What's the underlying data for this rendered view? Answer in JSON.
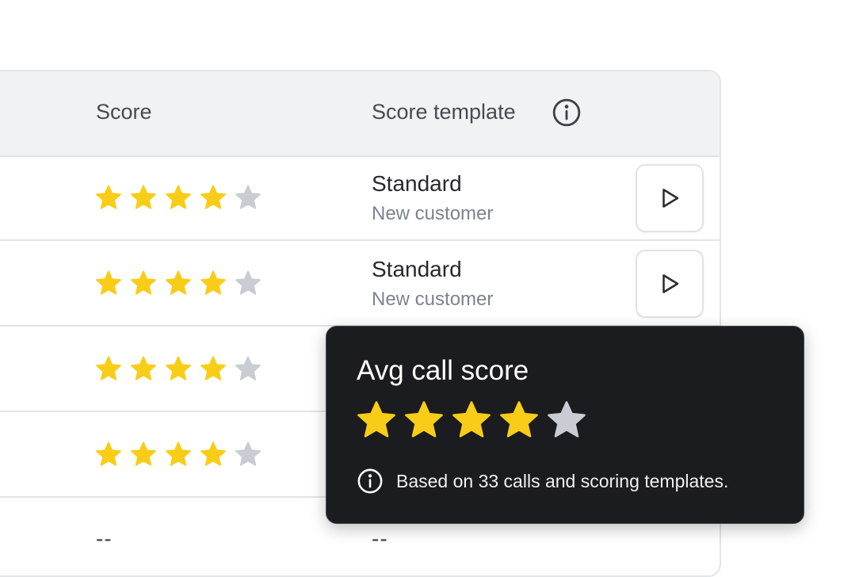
{
  "table": {
    "headers": {
      "score": "Score",
      "score_template": "Score template"
    },
    "header_info_icon": "info-icon",
    "rows": [
      {
        "rating": 4,
        "max": 5,
        "template_title": "Standard",
        "template_subtitle": "New customer",
        "action_icon": "play-icon"
      },
      {
        "rating": 4,
        "max": 5,
        "template_title": "Standard",
        "template_subtitle": "New customer",
        "action_icon": "play-icon"
      },
      {
        "rating": 4,
        "max": 5
      },
      {
        "rating": 4,
        "max": 5
      },
      {
        "score_placeholder": "--",
        "template_placeholder": "--"
      }
    ]
  },
  "tooltip": {
    "title": "Avg call score",
    "rating": 4,
    "max": 5,
    "info_icon": "info-icon",
    "text": "Based on 33 calls and scoring templates."
  },
  "colors": {
    "star_filled": "#f9cd17",
    "star_empty": "#c9ccd3",
    "tooltip_bg": "#1b1c20"
  }
}
